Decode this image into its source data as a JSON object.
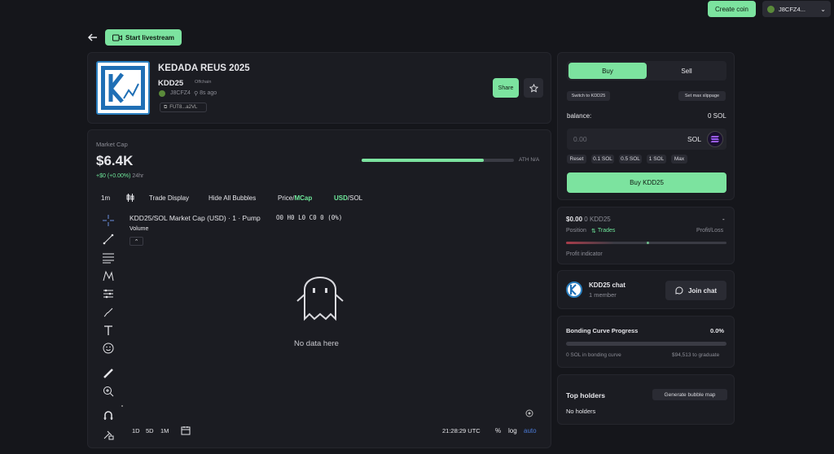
{
  "topbar": {
    "create_coin": "Create coin",
    "wallet": "J8CFZ4..."
  },
  "nav": {
    "start_livestream": "Start livestream"
  },
  "token": {
    "name": "KEDADA REUS 2025",
    "ticker": "KDD25",
    "chain_tag": "Offchain",
    "creator": "J8CFZ4",
    "age": "8s ago",
    "address": "FUT8...a2VL",
    "share": "Share"
  },
  "market": {
    "label": "Market Cap",
    "value": "$6.4K",
    "change": "+$0 (+0.00%)",
    "period": "24hr",
    "ath_label": "ATH N/A",
    "ath_progress": 0.8
  },
  "chart_toolbar": {
    "interval": "1m",
    "trade_display": "Trade Display",
    "hide_bubbles": "Hide All Bubbles",
    "price": "Price",
    "slash1": "/",
    "mcap": "MCap",
    "usd": "USD",
    "slash2": "/",
    "sol": "SOL"
  },
  "chart": {
    "title": "KDD25/SOL Market Cap (USD) · 1 · Pump",
    "ohlc": "O0 H0 L0 C0 0 (0%)",
    "volume_label": "Volume",
    "empty": "No data here",
    "ranges": [
      "1D",
      "5D",
      "1M"
    ],
    "time": "21:28:29 UTC",
    "percent": "%",
    "log": "log",
    "auto": "auto"
  },
  "trade": {
    "buy_tab": "Buy",
    "sell_tab": "Sell",
    "switch": "Switch to KDD25",
    "slippage": "Set max slippage",
    "balance_label": "balance:",
    "balance_value": "0 SOL",
    "amount_placeholder": "0.00",
    "currency": "SOL",
    "quick": [
      "Reset",
      "0.1 SOL",
      "0.5 SOL",
      "1 SOL",
      "Max"
    ],
    "buy_button": "Buy KDD25"
  },
  "position": {
    "value": "$0.00",
    "amount": "0 KDD25",
    "dash": "-",
    "position_label": "Position",
    "trades": "Trades",
    "pnl_label": "Profit/Loss",
    "indicator": "Profit indicator"
  },
  "chat": {
    "title": "KDD25 chat",
    "members": "1 member",
    "join": "Join chat"
  },
  "bonding": {
    "title": "Bonding Curve Progress",
    "percent": "0.0%",
    "progress": 0.0,
    "in_curve": "0 SOL in bonding curve",
    "to_graduate": "$94,513 to graduate"
  },
  "holders": {
    "title": "Top holders",
    "bubble_map": "Generate bubble map",
    "empty": "No holders"
  },
  "colors": {
    "accent": "#7ce39f",
    "background": "#15161b",
    "card": "#1b1c22"
  }
}
